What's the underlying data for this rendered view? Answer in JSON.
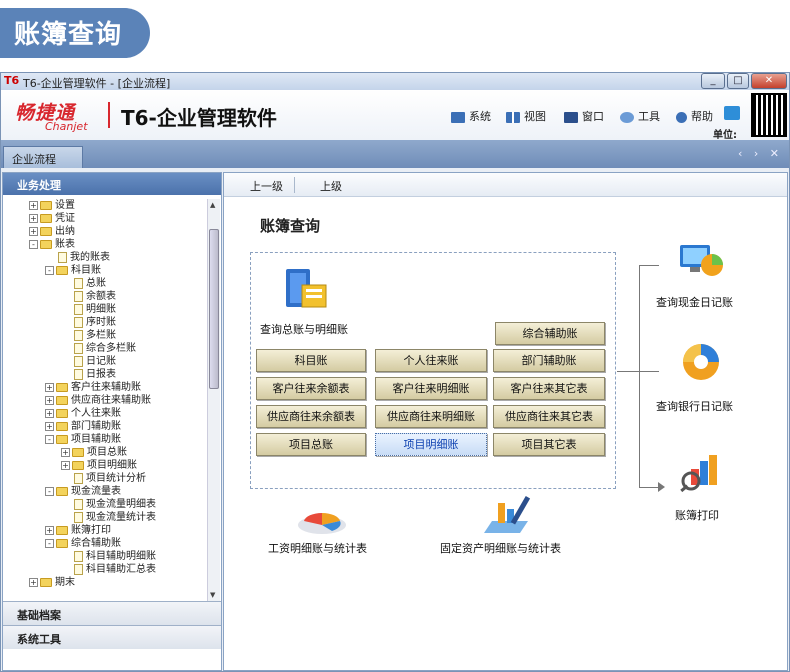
{
  "banner": {
    "title": "账簿查询"
  },
  "window": {
    "logo": "T6",
    "title": "T6-企业管理软件 - [企业流程]",
    "min": "_",
    "max": "□",
    "close": "✕"
  },
  "brand": {
    "logo_cn": "畅捷通",
    "logo_en": "Chanjet",
    "product": "T6-企业管理软件"
  },
  "toolbar": {
    "items": [
      "系统",
      "视图",
      "窗口",
      "工具",
      "帮助"
    ],
    "unit_label": "单位:"
  },
  "tabs": {
    "active": "企业流程",
    "arrows": "‹ › ✕"
  },
  "left": {
    "header": "业务处理",
    "tree": [
      {
        "label": "设置",
        "level": 0,
        "type": "folder",
        "exp": "+"
      },
      {
        "label": "凭证",
        "level": 0,
        "type": "folder",
        "exp": "+"
      },
      {
        "label": "出纳",
        "level": 0,
        "type": "folder",
        "exp": "+"
      },
      {
        "label": "账表",
        "level": 0,
        "type": "folder",
        "exp": "-"
      },
      {
        "label": "我的账表",
        "level": 1,
        "type": "doc",
        "exp": ""
      },
      {
        "label": "科目账",
        "level": 1,
        "type": "folder",
        "exp": "-"
      },
      {
        "label": "总账",
        "level": 2,
        "type": "doc",
        "exp": ""
      },
      {
        "label": "余额表",
        "level": 2,
        "type": "doc",
        "exp": ""
      },
      {
        "label": "明细账",
        "level": 2,
        "type": "doc",
        "exp": ""
      },
      {
        "label": "序时账",
        "level": 2,
        "type": "doc",
        "exp": ""
      },
      {
        "label": "多栏账",
        "level": 2,
        "type": "doc",
        "exp": ""
      },
      {
        "label": "综合多栏账",
        "level": 2,
        "type": "doc",
        "exp": ""
      },
      {
        "label": "日记账",
        "level": 2,
        "type": "doc",
        "exp": ""
      },
      {
        "label": "日报表",
        "level": 2,
        "type": "doc",
        "exp": ""
      },
      {
        "label": "客户往来辅助账",
        "level": 1,
        "type": "folder",
        "exp": "+"
      },
      {
        "label": "供应商往来辅助账",
        "level": 1,
        "type": "folder",
        "exp": "+"
      },
      {
        "label": "个人往来账",
        "level": 1,
        "type": "folder",
        "exp": "+"
      },
      {
        "label": "部门辅助账",
        "level": 1,
        "type": "folder",
        "exp": "+"
      },
      {
        "label": "项目辅助账",
        "level": 1,
        "type": "folder",
        "exp": "-"
      },
      {
        "label": "项目总账",
        "level": 2,
        "type": "folder",
        "exp": "+"
      },
      {
        "label": "项目明细账",
        "level": 2,
        "type": "folder",
        "exp": "+"
      },
      {
        "label": "项目统计分析",
        "level": 2,
        "type": "doc",
        "exp": ""
      },
      {
        "label": "现金流量表",
        "level": 1,
        "type": "folder",
        "exp": "-"
      },
      {
        "label": "现金流量明细表",
        "level": 2,
        "type": "doc",
        "exp": ""
      },
      {
        "label": "现金流量统计表",
        "level": 2,
        "type": "doc",
        "exp": ""
      },
      {
        "label": "账簿打印",
        "level": 1,
        "type": "folder",
        "exp": "+"
      },
      {
        "label": "综合辅助账",
        "level": 1,
        "type": "folder",
        "exp": "-"
      },
      {
        "label": "科目辅助明细账",
        "level": 2,
        "type": "doc",
        "exp": ""
      },
      {
        "label": "科目辅助汇总表",
        "level": 2,
        "type": "doc",
        "exp": ""
      },
      {
        "label": "期末",
        "level": 0,
        "type": "folder",
        "exp": "+"
      }
    ],
    "sections": [
      "基础档案",
      "系统工具"
    ]
  },
  "nav": {
    "up_level": "上一级",
    "parent": "上级"
  },
  "main": {
    "title": "账簿查询",
    "query_label": "查询总账与明细账",
    "buttons": [
      {
        "label": "综合辅助账"
      },
      {
        "label": "科目账"
      },
      {
        "label": "个人往来账"
      },
      {
        "label": "部门辅助账"
      },
      {
        "label": "客户往来余额表"
      },
      {
        "label": "客户往来明细账"
      },
      {
        "label": "客户往来其它表"
      },
      {
        "label": "供应商往来余额表"
      },
      {
        "label": "供应商往来明细账"
      },
      {
        "label": "供应商往来其它表"
      },
      {
        "label": "项目总账"
      },
      {
        "label": "项目明细账"
      },
      {
        "label": "项目其它表"
      }
    ],
    "cash_journal": "查询现金日记账",
    "bank_journal": "查询银行日记账",
    "print_books": "账簿打印",
    "salary": "工资明细账与统计表",
    "assets": "固定资产明细账与统计表"
  },
  "colors": {
    "banner": "#5b83b8",
    "tab_strip": "#7393bf",
    "button_fill": "#ded6b0",
    "selected_text": "#0b3fb0"
  }
}
